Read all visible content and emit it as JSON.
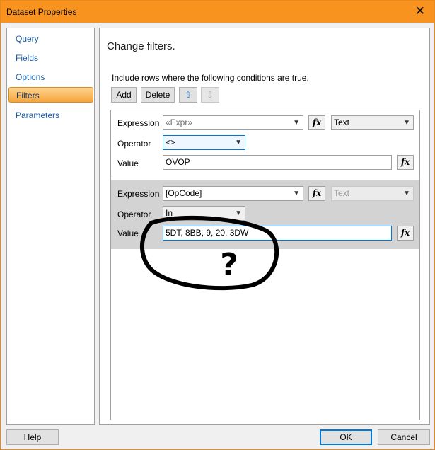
{
  "window": {
    "title": "Dataset Properties",
    "close_glyph": "✕"
  },
  "sidebar": {
    "items": [
      {
        "label": "Query"
      },
      {
        "label": "Fields"
      },
      {
        "label": "Options"
      },
      {
        "label": "Filters",
        "selected": true
      },
      {
        "label": "Parameters"
      }
    ]
  },
  "content": {
    "heading": "Change filters.",
    "instruction": "Include rows where the following conditions are true.",
    "toolbar": {
      "add_label": "Add",
      "delete_label": "Delete",
      "move_up_glyph": "⇧",
      "move_down_glyph": "⇩"
    }
  },
  "filters": [
    {
      "expression_label": "Expression",
      "expression": "«Expr»",
      "type": "Text",
      "operator_label": "Operator",
      "operator": "<>",
      "value_label": "Value",
      "value": "OVOP",
      "fx_label": "fx"
    },
    {
      "expression_label": "Expression",
      "expression": "[OpCode]",
      "type": "Text",
      "operator_label": "Operator",
      "operator": "In",
      "value_label": "Value",
      "value": "5DT, 8BB, 9, 20, 3DW",
      "fx_label": "fx"
    }
  ],
  "annotation": {
    "mark": "?"
  },
  "footer": {
    "help_label": "Help",
    "ok_label": "OK",
    "cancel_label": "Cancel"
  },
  "colors": {
    "titlebar": "#f7931e",
    "selected_item": "#f5a53b",
    "alt_row": "#d3d3d3",
    "focus_border": "#0078d7"
  },
  "icons": {
    "close": "close-icon",
    "move_up": "arrow-up-icon",
    "move_down": "arrow-down-icon",
    "expression": "fx-icon",
    "dropdown": "chevron-down-icon"
  }
}
